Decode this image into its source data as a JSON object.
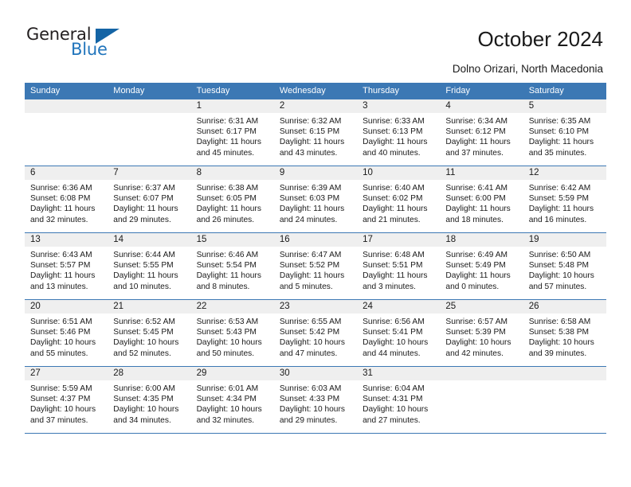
{
  "brand": {
    "name_top": "General",
    "name_bottom": "Blue",
    "triangle_color": "#1464a5",
    "blue": "#2175bc"
  },
  "header": {
    "title": "October 2024",
    "subtitle": "Dolno Orizari, North Macedonia"
  },
  "theme": {
    "header_blue": "#3c78b4",
    "daynum_bg": "#efefef",
    "text": "#1a1a1a"
  },
  "weekday_headers": [
    "Sunday",
    "Monday",
    "Tuesday",
    "Wednesday",
    "Thursday",
    "Friday",
    "Saturday"
  ],
  "labels": {
    "sunrise_prefix": "Sunrise: ",
    "sunset_prefix": "Sunset: ",
    "daylight_prefix": "Daylight: "
  },
  "weeks": [
    [
      {
        "day": "",
        "blank": true
      },
      {
        "day": "",
        "blank": true
      },
      {
        "day": "1",
        "sunrise": "Sunrise: 6:31 AM",
        "sunset": "Sunset: 6:17 PM",
        "daylight": "Daylight: 11 hours and 45 minutes."
      },
      {
        "day": "2",
        "sunrise": "Sunrise: 6:32 AM",
        "sunset": "Sunset: 6:15 PM",
        "daylight": "Daylight: 11 hours and 43 minutes."
      },
      {
        "day": "3",
        "sunrise": "Sunrise: 6:33 AM",
        "sunset": "Sunset: 6:13 PM",
        "daylight": "Daylight: 11 hours and 40 minutes."
      },
      {
        "day": "4",
        "sunrise": "Sunrise: 6:34 AM",
        "sunset": "Sunset: 6:12 PM",
        "daylight": "Daylight: 11 hours and 37 minutes."
      },
      {
        "day": "5",
        "sunrise": "Sunrise: 6:35 AM",
        "sunset": "Sunset: 6:10 PM",
        "daylight": "Daylight: 11 hours and 35 minutes."
      }
    ],
    [
      {
        "day": "6",
        "sunrise": "Sunrise: 6:36 AM",
        "sunset": "Sunset: 6:08 PM",
        "daylight": "Daylight: 11 hours and 32 minutes."
      },
      {
        "day": "7",
        "sunrise": "Sunrise: 6:37 AM",
        "sunset": "Sunset: 6:07 PM",
        "daylight": "Daylight: 11 hours and 29 minutes."
      },
      {
        "day": "8",
        "sunrise": "Sunrise: 6:38 AM",
        "sunset": "Sunset: 6:05 PM",
        "daylight": "Daylight: 11 hours and 26 minutes."
      },
      {
        "day": "9",
        "sunrise": "Sunrise: 6:39 AM",
        "sunset": "Sunset: 6:03 PM",
        "daylight": "Daylight: 11 hours and 24 minutes."
      },
      {
        "day": "10",
        "sunrise": "Sunrise: 6:40 AM",
        "sunset": "Sunset: 6:02 PM",
        "daylight": "Daylight: 11 hours and 21 minutes."
      },
      {
        "day": "11",
        "sunrise": "Sunrise: 6:41 AM",
        "sunset": "Sunset: 6:00 PM",
        "daylight": "Daylight: 11 hours and 18 minutes."
      },
      {
        "day": "12",
        "sunrise": "Sunrise: 6:42 AM",
        "sunset": "Sunset: 5:59 PM",
        "daylight": "Daylight: 11 hours and 16 minutes."
      }
    ],
    [
      {
        "day": "13",
        "sunrise": "Sunrise: 6:43 AM",
        "sunset": "Sunset: 5:57 PM",
        "daylight": "Daylight: 11 hours and 13 minutes."
      },
      {
        "day": "14",
        "sunrise": "Sunrise: 6:44 AM",
        "sunset": "Sunset: 5:55 PM",
        "daylight": "Daylight: 11 hours and 10 minutes."
      },
      {
        "day": "15",
        "sunrise": "Sunrise: 6:46 AM",
        "sunset": "Sunset: 5:54 PM",
        "daylight": "Daylight: 11 hours and 8 minutes."
      },
      {
        "day": "16",
        "sunrise": "Sunrise: 6:47 AM",
        "sunset": "Sunset: 5:52 PM",
        "daylight": "Daylight: 11 hours and 5 minutes."
      },
      {
        "day": "17",
        "sunrise": "Sunrise: 6:48 AM",
        "sunset": "Sunset: 5:51 PM",
        "daylight": "Daylight: 11 hours and 3 minutes."
      },
      {
        "day": "18",
        "sunrise": "Sunrise: 6:49 AM",
        "sunset": "Sunset: 5:49 PM",
        "daylight": "Daylight: 11 hours and 0 minutes."
      },
      {
        "day": "19",
        "sunrise": "Sunrise: 6:50 AM",
        "sunset": "Sunset: 5:48 PM",
        "daylight": "Daylight: 10 hours and 57 minutes."
      }
    ],
    [
      {
        "day": "20",
        "sunrise": "Sunrise: 6:51 AM",
        "sunset": "Sunset: 5:46 PM",
        "daylight": "Daylight: 10 hours and 55 minutes."
      },
      {
        "day": "21",
        "sunrise": "Sunrise: 6:52 AM",
        "sunset": "Sunset: 5:45 PM",
        "daylight": "Daylight: 10 hours and 52 minutes."
      },
      {
        "day": "22",
        "sunrise": "Sunrise: 6:53 AM",
        "sunset": "Sunset: 5:43 PM",
        "daylight": "Daylight: 10 hours and 50 minutes."
      },
      {
        "day": "23",
        "sunrise": "Sunrise: 6:55 AM",
        "sunset": "Sunset: 5:42 PM",
        "daylight": "Daylight: 10 hours and 47 minutes."
      },
      {
        "day": "24",
        "sunrise": "Sunrise: 6:56 AM",
        "sunset": "Sunset: 5:41 PM",
        "daylight": "Daylight: 10 hours and 44 minutes."
      },
      {
        "day": "25",
        "sunrise": "Sunrise: 6:57 AM",
        "sunset": "Sunset: 5:39 PM",
        "daylight": "Daylight: 10 hours and 42 minutes."
      },
      {
        "day": "26",
        "sunrise": "Sunrise: 6:58 AM",
        "sunset": "Sunset: 5:38 PM",
        "daylight": "Daylight: 10 hours and 39 minutes."
      }
    ],
    [
      {
        "day": "27",
        "sunrise": "Sunrise: 5:59 AM",
        "sunset": "Sunset: 4:37 PM",
        "daylight": "Daylight: 10 hours and 37 minutes."
      },
      {
        "day": "28",
        "sunrise": "Sunrise: 6:00 AM",
        "sunset": "Sunset: 4:35 PM",
        "daylight": "Daylight: 10 hours and 34 minutes."
      },
      {
        "day": "29",
        "sunrise": "Sunrise: 6:01 AM",
        "sunset": "Sunset: 4:34 PM",
        "daylight": "Daylight: 10 hours and 32 minutes."
      },
      {
        "day": "30",
        "sunrise": "Sunrise: 6:03 AM",
        "sunset": "Sunset: 4:33 PM",
        "daylight": "Daylight: 10 hours and 29 minutes."
      },
      {
        "day": "31",
        "sunrise": "Sunrise: 6:04 AM",
        "sunset": "Sunset: 4:31 PM",
        "daylight": "Daylight: 10 hours and 27 minutes."
      },
      {
        "day": "",
        "blank": true
      },
      {
        "day": "",
        "blank": true
      }
    ]
  ]
}
